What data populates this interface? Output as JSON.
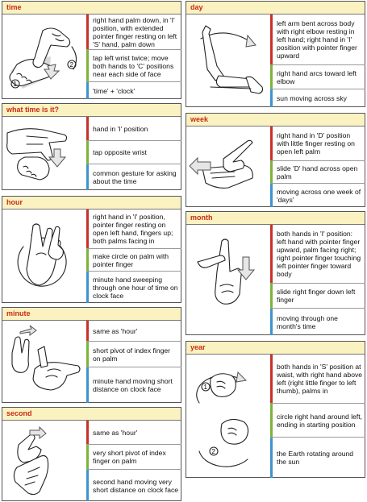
{
  "cards": {
    "time": {
      "title": "time",
      "rows": [
        "right hand palm down, in 'I' position, with extended pointer finger resting on left 'S' hand, palm down",
        "tap left wrist twice; move both hands to 'C' positions near each side of face",
        "'time' + 'clock'"
      ]
    },
    "what_time": {
      "title": "what time is it?",
      "rows": [
        "hand in 'I' position",
        "tap opposite wrist",
        "common gesture for asking about the time"
      ]
    },
    "hour": {
      "title": "hour",
      "rows": [
        "right hand in 'I' position, pointer finger resting on open left hand, fingers up; both palms facing in",
        "make circle on palm with pointer finger",
        "minute hand sweeping through one hour of time on clock face"
      ]
    },
    "minute": {
      "title": "minute",
      "rows": [
        "same as 'hour'",
        "short pivot of index finger on palm",
        "minute hand moving short distance on clock face"
      ]
    },
    "second": {
      "title": "second",
      "rows": [
        "same as 'hour'",
        "very short pivot of index finger on palm",
        "second hand moving very short distance on clock face"
      ]
    },
    "day": {
      "title": "day",
      "rows": [
        "left arm bent across body with right elbow resting in left hand; right hand in 'I' position with pointer finger upward",
        "right hand arcs toward left elbow",
        "sun moving across sky"
      ]
    },
    "week": {
      "title": "week",
      "rows": [
        "right hand in 'D' position with little finger resting on open left palm",
        "slide 'D' hand across open palm",
        "moving across one week of 'days'"
      ]
    },
    "month": {
      "title": "month",
      "rows": [
        "both hands in 'I' position: left hand with pointer finger upward, palm facing right; right pointer finger touching left pointer finger toward body",
        "slide right finger down left finger",
        "moving through one month's time"
      ]
    },
    "year": {
      "title": "year",
      "rows": [
        "both hands in 'S' position at waist, with right hand above left (right little finger to left thumb), palms in",
        "circle right hand around left, ending in starting position",
        "the Earth rotating around the sun"
      ]
    }
  },
  "markers": {
    "one": "1",
    "two": "2"
  },
  "colors": {
    "header_bg": "#fbf2c2",
    "title": "#c92b12",
    "bar_red": "#c8302a",
    "bar_green": "#7bb33b",
    "bar_blue": "#3f93cc"
  }
}
